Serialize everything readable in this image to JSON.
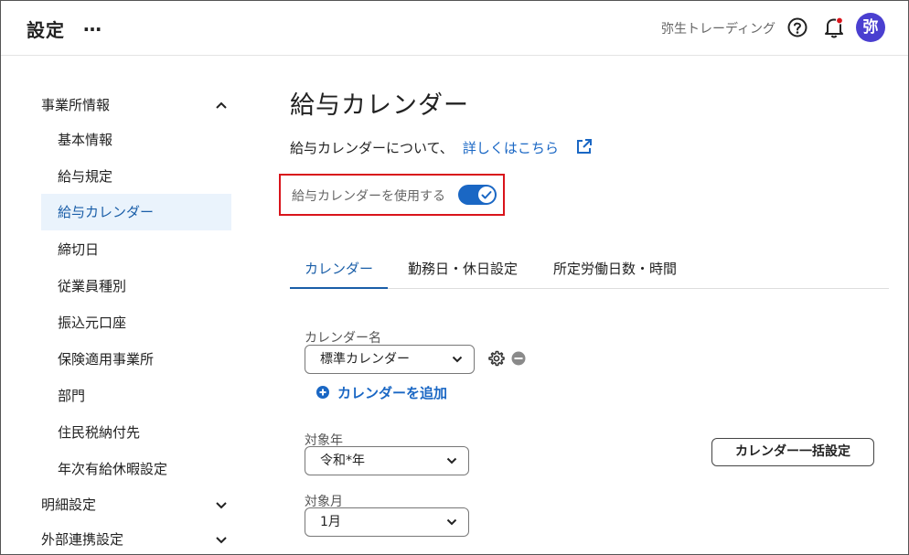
{
  "header": {
    "title": "設定",
    "more": "…",
    "company": "弥生トレーディング",
    "avatar": "弥"
  },
  "sidebar": {
    "items": [
      {
        "label": "事業所情報",
        "expanded": true
      },
      {
        "label": "基本情報"
      },
      {
        "label": "給与規定"
      },
      {
        "label": "給与カレンダー",
        "active": true
      },
      {
        "label": "締切日"
      },
      {
        "label": "従業員種別"
      },
      {
        "label": "振込元口座"
      },
      {
        "label": "保険適用事業所"
      },
      {
        "label": "部門"
      },
      {
        "label": "住民税納付先"
      },
      {
        "label": "年次有給休暇設定"
      },
      {
        "label": "明細設定",
        "expanded": false
      },
      {
        "label": "外部連携設定",
        "expanded": false
      }
    ]
  },
  "main": {
    "title": "給与カレンダー",
    "about_text": "給与カレンダーについて、",
    "about_link": "詳しくはこちら",
    "toggle_label": "給与カレンダーを使用する",
    "toggle_on": true,
    "tabs": [
      {
        "label": "カレンダー",
        "active": true
      },
      {
        "label": "勤務日・休日設定"
      },
      {
        "label": "所定労働日数・時間"
      }
    ],
    "calendar_name_label": "カレンダー名",
    "calendar_name_value": "標準カレンダー",
    "add_calendar": "カレンダーを追加",
    "year_label": "対象年",
    "year_value": "令和*年",
    "month_label": "対象月",
    "month_value": "1月",
    "bulk_button": "カレンダー一括設定"
  },
  "colors": {
    "accent": "#1a67c4",
    "active_bg": "#eaf3fc",
    "highlight_border": "#d9141b",
    "avatar_bg": "#4a3fd0",
    "notification_dot": "#d9141b"
  }
}
